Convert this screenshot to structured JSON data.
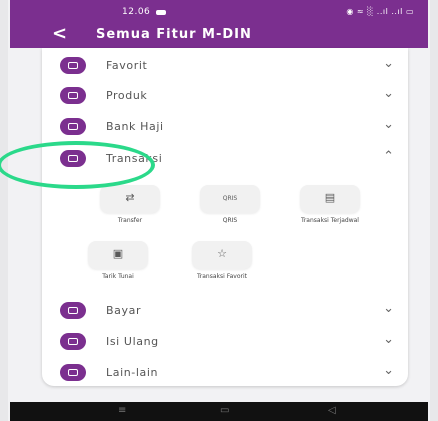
{
  "status": {
    "time": "12.06",
    "right": "◉ ≈ ░ ..ıl ..ıl ▭"
  },
  "header": {
    "title": "Semua Fitur M-DIN"
  },
  "menu": [
    {
      "label": "Favorit",
      "icon": "star-icon",
      "expanded": false
    },
    {
      "label": "Produk",
      "icon": "product-icon",
      "expanded": false
    },
    {
      "label": "Bank Haji",
      "icon": "bank-icon",
      "expanded": false
    },
    {
      "label": "Transaksi",
      "icon": "transaction-icon",
      "expanded": true
    },
    {
      "label": "Bayar",
      "icon": "payment-icon",
      "expanded": false
    },
    {
      "label": "Isi Ulang",
      "icon": "topup-icon",
      "expanded": false
    },
    {
      "label": "Lain-lain",
      "icon": "more-icon",
      "expanded": false
    }
  ],
  "transaksi_items": [
    {
      "label": "Transfer",
      "glyph": "⇄",
      "icon": "transfer-icon"
    },
    {
      "label": "QRIS",
      "glyph": "QRIS",
      "icon": "qris-icon"
    },
    {
      "label": "Transaksi Terjadwal",
      "glyph": "▤",
      "icon": "calendar-icon"
    },
    {
      "label": "Tarik Tunai",
      "glyph": "▣",
      "icon": "atm-icon"
    },
    {
      "label": "Transaksi Favorit",
      "glyph": "☆",
      "icon": "star-outline-icon"
    }
  ],
  "chevrons": {
    "down": "⌄",
    "up": "⌃"
  },
  "navbar": {
    "menu": "≡",
    "home": "▭",
    "back": "◁"
  },
  "colors": {
    "primary": "#7b2f8f",
    "highlight": "#2bd98a"
  }
}
